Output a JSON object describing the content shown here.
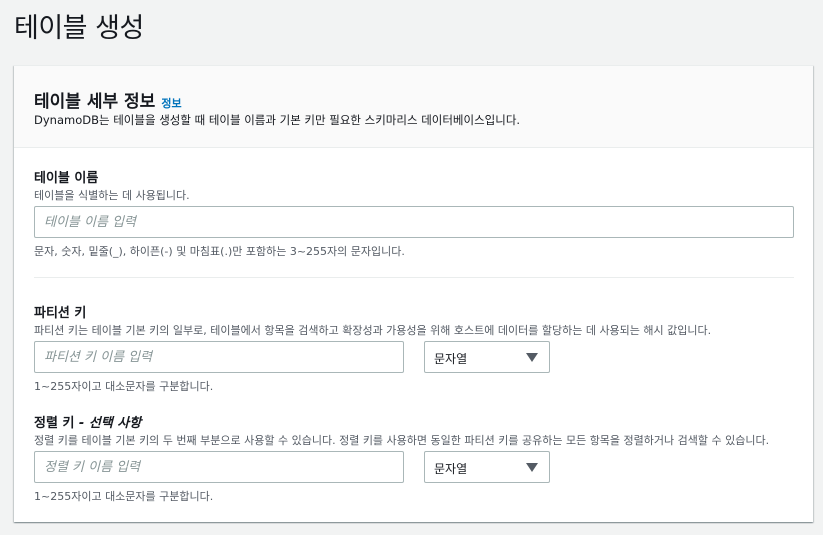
{
  "page": {
    "title": "테이블 생성"
  },
  "details": {
    "title": "테이블 세부 정보",
    "info_link": "정보",
    "description": "DynamoDB는 테이블을 생성할 때 테이블 이름과 기본 키만 필요한 스키마리스 데이터베이스입니다."
  },
  "table_name": {
    "label": "테이블 이름",
    "description": "테이블을 식별하는 데 사용됩니다.",
    "placeholder": "테이블 이름 입력",
    "value": "",
    "constraint": "문자, 숫자, 밑줄(_), 하이픈(-) 및 마침표(.)만 포함하는 3~255자의 문자입니다."
  },
  "partition_key": {
    "label": "파티션 키",
    "description": "파티션 키는 테이블 기본 키의 일부로, 테이블에서 항목을 검색하고 확장성과 가용성을 위해 호스트에 데이터를 할당하는 데 사용되는 해시 값입니다.",
    "placeholder": "파티션 키 이름 입력",
    "value": "",
    "type_selected": "문자열",
    "constraint": "1~255자이고 대소문자를 구분합니다."
  },
  "sort_key": {
    "label": "정렬 키",
    "optional_label": " - 선택 사항",
    "description": "정렬 키를 테이블 기본 키의 두 번째 부분으로 사용할 수 있습니다. 정렬 키를 사용하면 동일한 파티션 키를 공유하는 모든 항목을 정렬하거나 검색할 수 있습니다.",
    "placeholder": "정렬 키 이름 입력",
    "value": "",
    "type_selected": "문자열",
    "constraint": "1~255자이고 대소문자를 구분합니다."
  },
  "colors": {
    "background": "#f2f3f3",
    "panel": "#ffffff",
    "header": "#fafafa",
    "link": "#0073bb",
    "text": "#16191f",
    "secondary_text": "#545b64",
    "border": "#aab7b8"
  }
}
